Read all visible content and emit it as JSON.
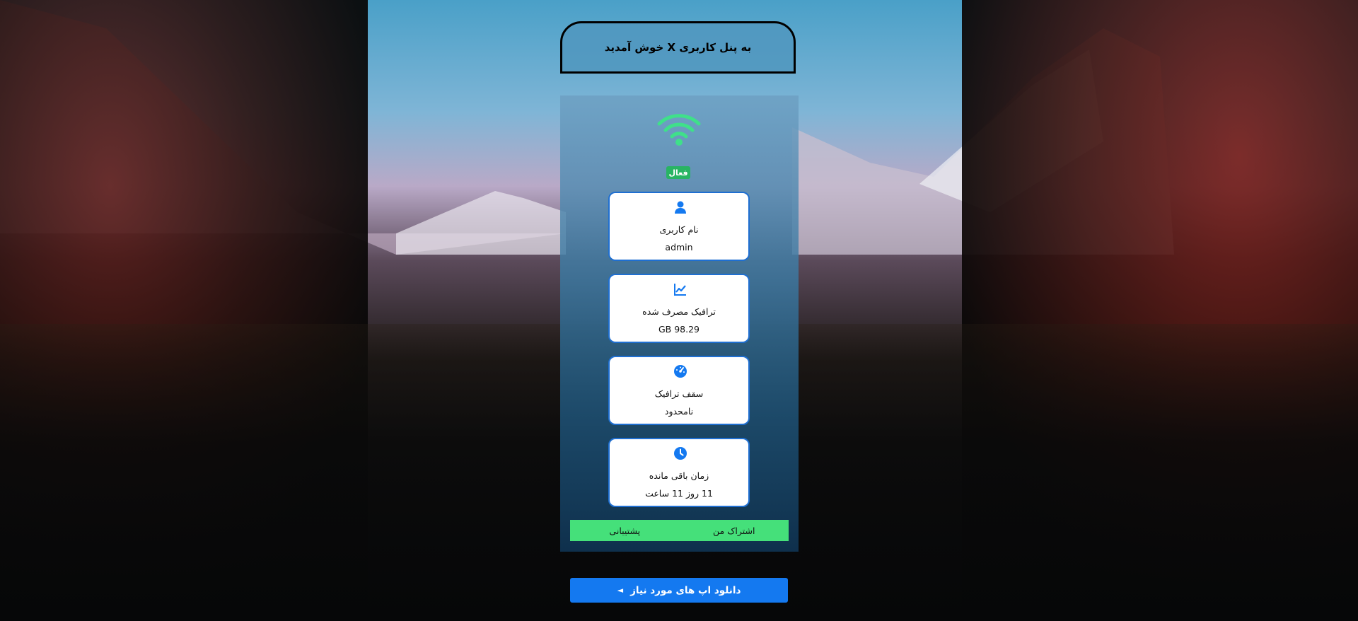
{
  "header": {
    "title": "به پنل کاربری X خوش آمدید"
  },
  "status": {
    "label": "فعال"
  },
  "cards": [
    {
      "icon": "user-icon",
      "label": "نام کاربری",
      "value": "admin"
    },
    {
      "icon": "chart-line-icon",
      "label": "ترافیک مصرف شده",
      "value": "GB 98.29"
    },
    {
      "icon": "gauge-icon",
      "label": "سقف ترافیک",
      "value": "نامحدود"
    },
    {
      "icon": "clock-icon",
      "label": "زمان باقی مانده",
      "value": "11 روز 11 ساعت"
    }
  ],
  "tabs": [
    {
      "label": "اشتراک من"
    },
    {
      "label": "پشتیبانی"
    }
  ],
  "download": {
    "label": "دانلود اپ های مورد نیاز",
    "arrow": "◄"
  },
  "colors": {
    "accent": "#1479f0",
    "status": "#28b463",
    "tabs_bg": "#45e07a",
    "wifi": "#3fe08a"
  }
}
